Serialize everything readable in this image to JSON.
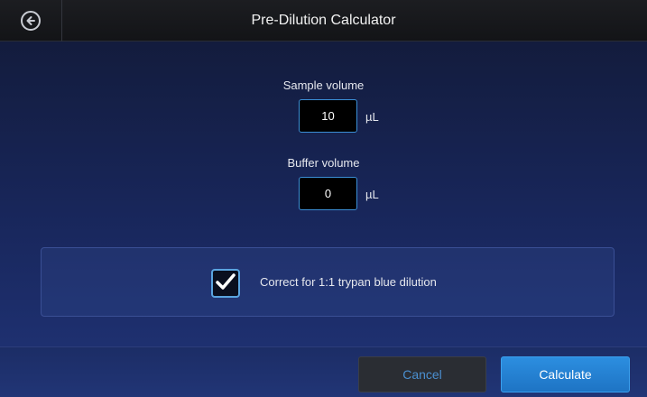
{
  "header": {
    "title": "Pre-Dilution Calculator",
    "back_icon": "arrow-left-circle-icon"
  },
  "form": {
    "sample": {
      "label": "Sample volume",
      "value": "10",
      "unit": "µL"
    },
    "buffer": {
      "label": "Buffer volume",
      "value": "0",
      "unit": "µL"
    },
    "trypan": {
      "label": "Correct for 1:1 trypan blue dilution",
      "checked": true,
      "icon": "checkmark-icon"
    }
  },
  "footer": {
    "cancel_label": "Cancel",
    "calculate_label": "Calculate"
  },
  "colors": {
    "accent": "#2c8ee0",
    "input_border": "#3b8fd6",
    "cancel_text": "#4a8fd0"
  }
}
